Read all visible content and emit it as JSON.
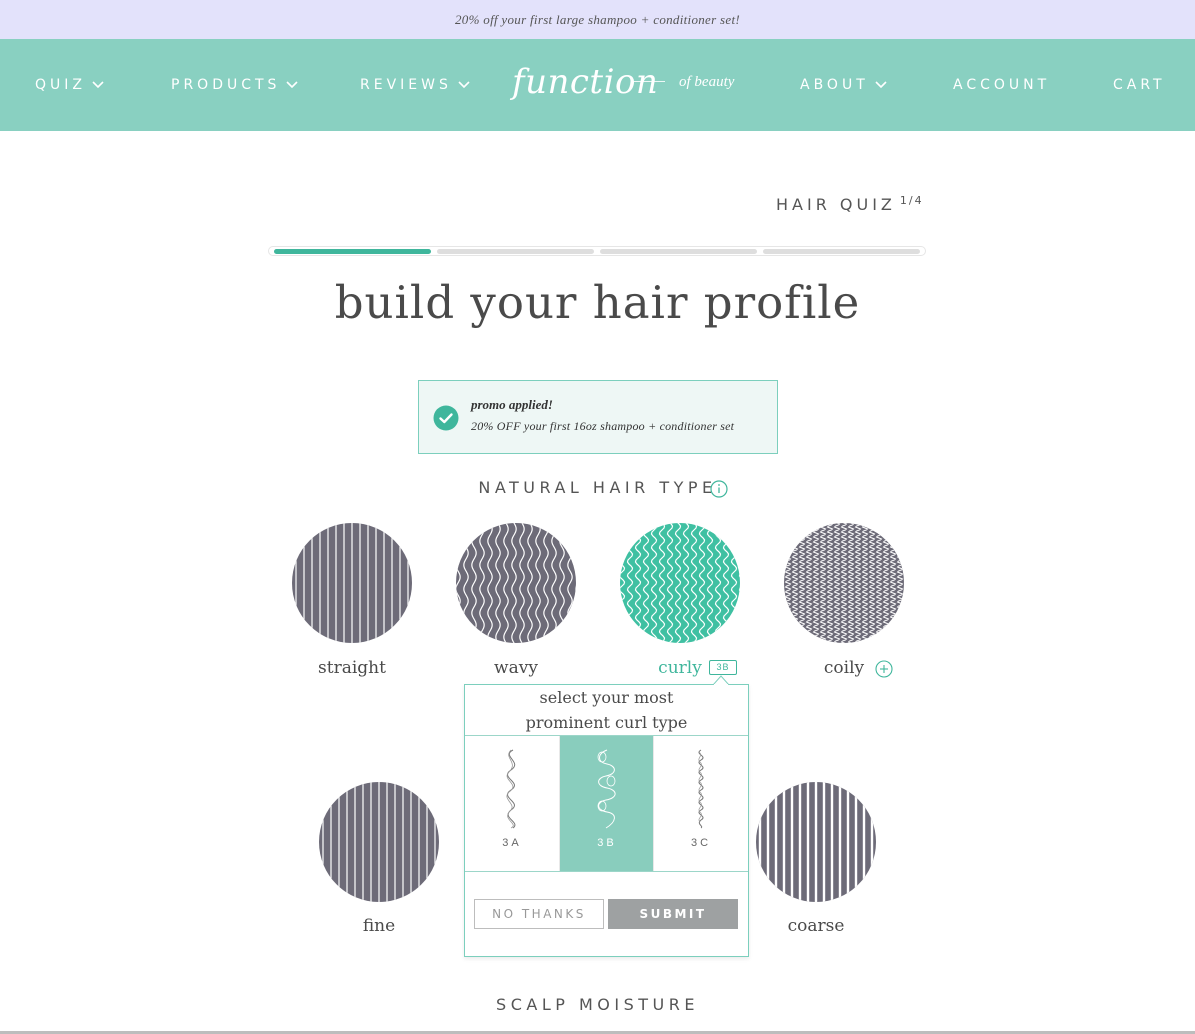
{
  "promo_bar": {
    "text": "20% off your first large shampoo + conditioner set!"
  },
  "nav": {
    "left": [
      {
        "label": "QUIZ",
        "icon": "chevron-down-icon"
      },
      {
        "label": "PRODUCTS",
        "icon": "chevron-down-icon"
      },
      {
        "label": "REVIEWS",
        "icon": "chevron-down-icon"
      }
    ],
    "logo": {
      "main": "function",
      "sub": "of beauty"
    },
    "right": [
      {
        "label": "ABOUT",
        "icon": "chevron-down-icon"
      },
      {
        "label": "ACCOUNT"
      },
      {
        "label": "CART"
      }
    ],
    "color": "#89d0c1"
  },
  "quiz": {
    "title": "HAIR QUIZ",
    "step": "1/4",
    "progress": {
      "current": 1,
      "total": 4
    },
    "accent": "#3fb69c"
  },
  "page_title": "build your hair profile",
  "promo_box": {
    "title": "promo applied!",
    "desc": "20% OFF your first 16oz shampoo + conditioner set",
    "icon": "check-circle-icon"
  },
  "hair_type": {
    "heading": "NATURAL HAIR TYPE",
    "info_icon": "info-icon",
    "options": [
      {
        "label": "straight",
        "selected": false
      },
      {
        "label": "wavy",
        "selected": false
      },
      {
        "label": "curly",
        "selected": true,
        "badge": "3B"
      },
      {
        "label": "coily",
        "selected": false,
        "icon": "plus-circle-icon"
      }
    ]
  },
  "curl_popup": {
    "title_line1": "select your most",
    "title_line2": "prominent curl type",
    "options": [
      {
        "label": "3A",
        "selected": false
      },
      {
        "label": "3B",
        "selected": true
      },
      {
        "label": "3C",
        "selected": false
      }
    ],
    "no_thanks": "NO THANKS",
    "submit": "SUBMIT"
  },
  "hair_texture": {
    "options": [
      {
        "label": "fine"
      },
      {
        "label": "coarse"
      }
    ]
  },
  "scalp_moisture": {
    "heading": "SCALP MOISTURE"
  }
}
